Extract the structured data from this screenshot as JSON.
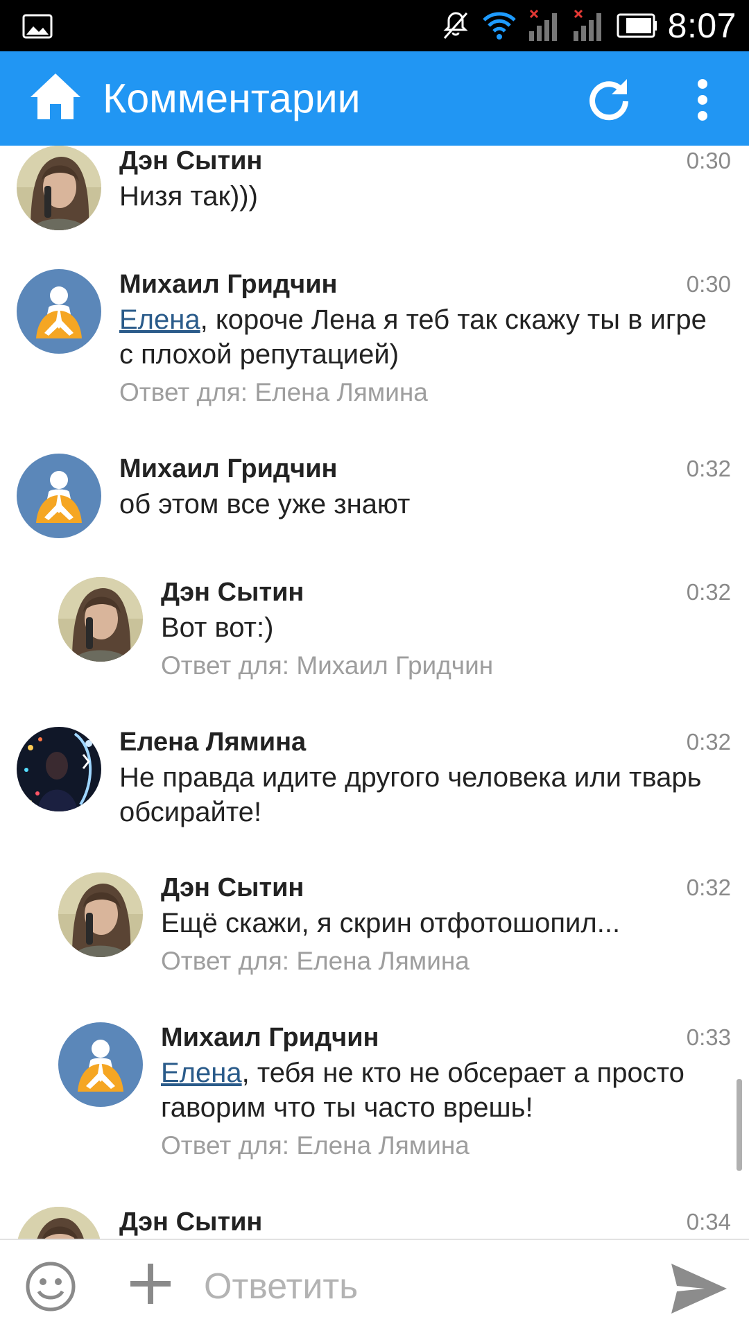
{
  "status_bar": {
    "time": "8:07",
    "icons": [
      "gallery-icon",
      "mute-icon",
      "wifi-icon",
      "signal-no-service-icon",
      "signal-no-service-icon",
      "battery-icon"
    ]
  },
  "app_bar": {
    "title": "Комментарии",
    "icons": [
      "home-icon",
      "refresh-icon",
      "more-vert-icon"
    ],
    "color": "#2196F3"
  },
  "comments": [
    {
      "author": "Дэн Сытин",
      "time": "0:30",
      "text": "Низя так)))",
      "reply_label": "",
      "avatar": "photo-woman"
    },
    {
      "author": "Михаил Гридчин",
      "time": "0:30",
      "mention": "Елена",
      "text": ", короче Лена я теб так скажу ты в игре с плохой репутацией)",
      "reply_label": "Ответ для: Елена Лямина",
      "avatar": "praying-person"
    },
    {
      "author": "Михаил Гридчин",
      "time": "0:32",
      "text": "об этом все уже знают",
      "reply_label": "",
      "avatar": "praying-person"
    },
    {
      "author": "Дэн Сытин",
      "time": "0:32",
      "text": "Вот вот:)",
      "reply_label": "Ответ для: Михаил Гридчин",
      "avatar": "photo-woman"
    },
    {
      "author": "Елена Лямина",
      "time": "0:32",
      "text": "Не правда идите другого человека или тварь обсирайте!",
      "reply_label": "",
      "avatar": "photo-night"
    },
    {
      "author": "Дэн Сытин",
      "time": "0:32",
      "text": "Ещё скажи, я скрин отфотошопил...",
      "reply_label": "Ответ для: Елена Лямина",
      "avatar": "photo-woman"
    },
    {
      "author": "Михаил Гридчин",
      "time": "0:33",
      "mention": "Елена",
      "text": ", тебя не кто не обсерает а просто гаворим что ты часто врешь!",
      "reply_label": "Ответ для: Елена Лямина",
      "avatar": "praying-person"
    },
    {
      "author": "Дэн Сытин",
      "time": "0:34",
      "text": "",
      "reply_label": "",
      "avatar": "photo-woman"
    }
  ],
  "input_bar": {
    "placeholder": "Ответить",
    "icons": [
      "emoji-icon",
      "add-icon",
      "send-icon"
    ]
  }
}
